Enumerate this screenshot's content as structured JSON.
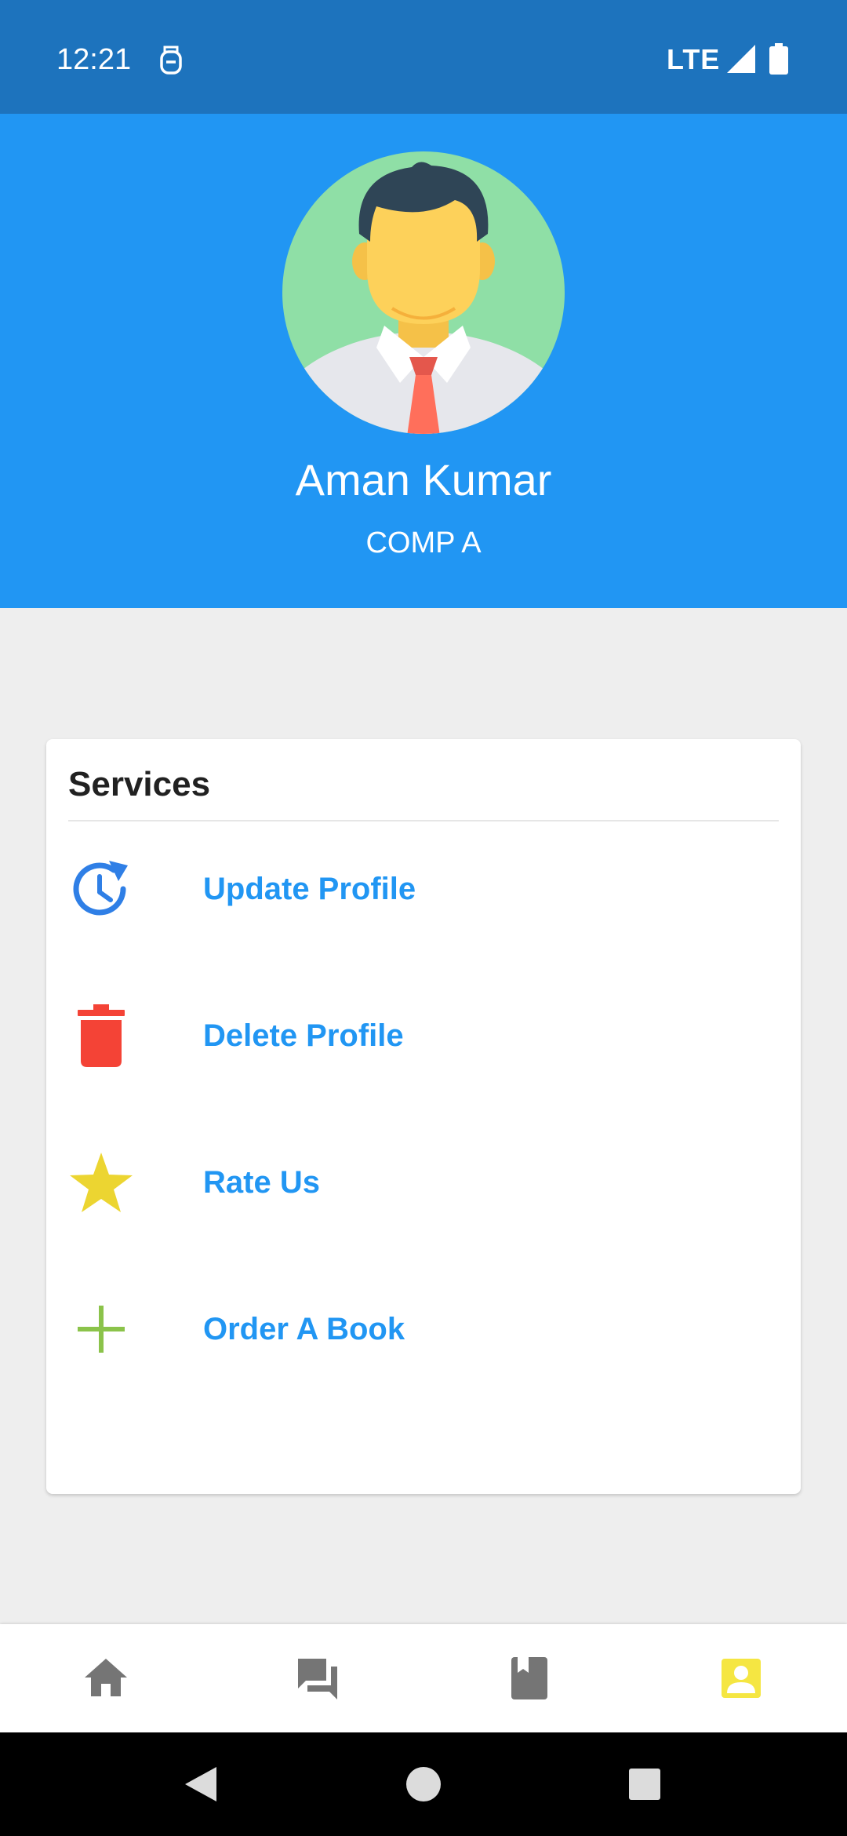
{
  "status_bar": {
    "time": "12:21",
    "network": "LTE",
    "icons": [
      "sim-icon",
      "signal-icon",
      "battery-icon"
    ]
  },
  "profile": {
    "name": "Aman Kumar",
    "company": "COMP A",
    "avatar_icon": "male-avatar-icon"
  },
  "services": {
    "title": "Services",
    "items": [
      {
        "label": "Update Profile",
        "icon": "update-icon",
        "color": "#2f7fe6"
      },
      {
        "label": "Delete Profile",
        "icon": "trash-icon",
        "color": "#f44336"
      },
      {
        "label": "Rate Us",
        "icon": "star-icon",
        "color": "#ecd531"
      },
      {
        "label": "Order A Book",
        "icon": "plus-icon",
        "color": "#8bc34a"
      }
    ]
  },
  "bottom_nav": {
    "items": [
      {
        "icon": "home-icon",
        "active": false
      },
      {
        "icon": "chat-icon",
        "active": false
      },
      {
        "icon": "book-icon",
        "active": false
      },
      {
        "icon": "profile-icon",
        "active": true
      }
    ],
    "active_color": "#f5e642",
    "inactive_color": "#757575"
  },
  "system_nav": {
    "buttons": [
      "back-icon",
      "home-circle-icon",
      "recents-icon"
    ]
  },
  "colors": {
    "status_bar": "#1d73bd",
    "header": "#2196f3",
    "accent_text": "#2196f3",
    "background": "#eeeeee"
  }
}
